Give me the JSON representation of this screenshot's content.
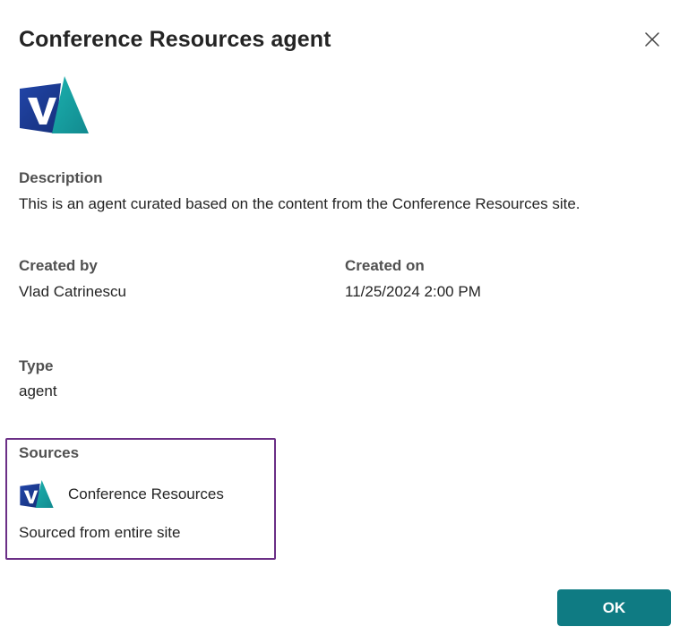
{
  "dialog": {
    "title": "Conference Resources agent",
    "close_icon": "close-icon"
  },
  "logo": {
    "icon": "site-logo-icon",
    "colors": [
      "#1e3f9a",
      "#1aa6a6"
    ]
  },
  "description": {
    "label": "Description",
    "value": "This is an agent curated based on the content from the Conference Resources site."
  },
  "created_by": {
    "label": "Created by",
    "value": "Vlad Catrinescu"
  },
  "created_on": {
    "label": "Created on",
    "value": "11/25/2024 2:00 PM"
  },
  "type": {
    "label": "Type",
    "value": "agent"
  },
  "sources": {
    "label": "Sources",
    "items": [
      {
        "name": "Conference Resources",
        "icon": "site-logo-icon"
      }
    ],
    "scope": "Sourced from entire site",
    "highlight_color": "#6b2f86"
  },
  "footer": {
    "ok_label": "OK",
    "ok_color": "#0f7b83"
  }
}
